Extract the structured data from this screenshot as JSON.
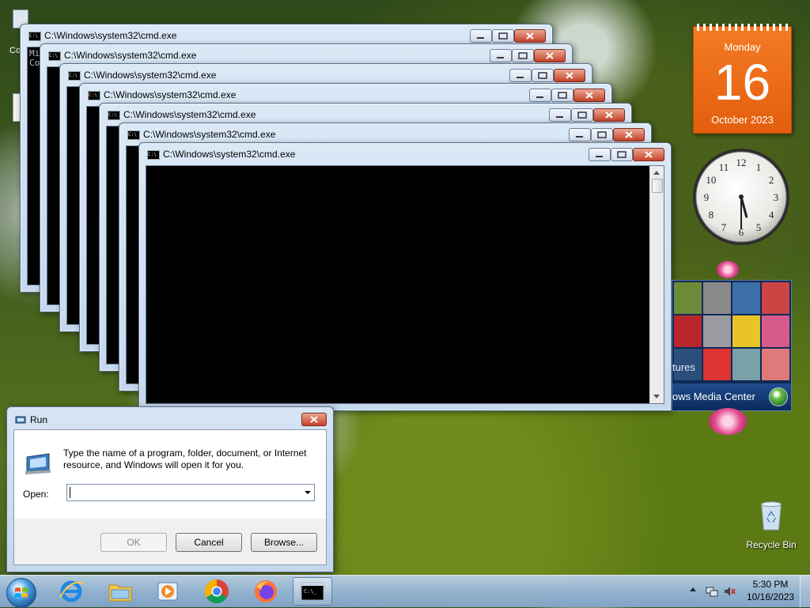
{
  "desktop": {
    "left_icon_label": "Co",
    "recycle_bin_label": "Recycle Bin"
  },
  "cmd_windows": [
    {
      "title": "C:\\Windows\\system32\\cmd.exe",
      "console_lines": [
        "Mi",
        "Co"
      ]
    },
    {
      "title": "C:\\Windows\\system32\\cmd.exe"
    },
    {
      "title": "C:\\Windows\\system32\\cmd.exe"
    },
    {
      "title": "C:\\Windows\\system32\\cmd.exe"
    },
    {
      "title": "C:\\Windows\\system32\\cmd.exe"
    },
    {
      "title": "C:\\Windows\\system32\\cmd.exe"
    },
    {
      "title": "C:\\Windows\\system32\\cmd.exe"
    }
  ],
  "calendar_gadget": {
    "weekday": "Monday",
    "day": "16",
    "month_year": "October 2023"
  },
  "clock_gadget": {
    "numerals": [
      "12",
      "1",
      "2",
      "3",
      "4",
      "5",
      "6",
      "7",
      "8",
      "9",
      "10",
      "11"
    ],
    "time_shown": "5:30"
  },
  "media_center_gadget": {
    "caption_partial": "tures",
    "title_partial": "ows Media Center"
  },
  "run_dialog": {
    "title": "Run",
    "description": "Type the name of a program, folder, document, or Internet resource, and Windows will open it for you.",
    "open_label": "Open:",
    "open_value": "",
    "ok_label": "OK",
    "cancel_label": "Cancel",
    "browse_label": "Browse..."
  },
  "taskbar": {
    "pinned": [
      "internet-explorer-icon",
      "windows-explorer-icon",
      "media-player-icon",
      "chrome-icon",
      "firefox-icon",
      "cmd-icon"
    ],
    "time": "5:30 PM",
    "date": "10/16/2023"
  },
  "colors": {
    "calendar_orange": "#ef6c1a",
    "titlebar_blue": "#c8daef",
    "close_red": "#c8442a",
    "taskbar_blue": "#9cb9da"
  }
}
